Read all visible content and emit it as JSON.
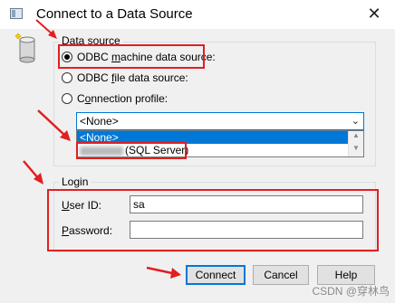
{
  "window": {
    "title": "Connect to a Data Source",
    "close_glyph": "✕"
  },
  "data_source": {
    "legend": "Data source",
    "options": [
      {
        "pre": "ODBC ",
        "accel": "m",
        "post": "achine data source:",
        "checked": true
      },
      {
        "pre": "ODBC ",
        "accel": "f",
        "post": "ile data source:",
        "checked": false
      },
      {
        "pre": "C",
        "accel": "o",
        "post": "nnection profile:",
        "checked": false
      }
    ],
    "select_value": "<None>",
    "dropdown_items": [
      "<None>",
      "(SQL Server)"
    ]
  },
  "login": {
    "legend": "Login",
    "userid_accel": "U",
    "userid_rest": "ser ID:",
    "userid_value": "sa",
    "password_accel": "P",
    "password_rest": "assword:",
    "password_value": ""
  },
  "buttons": {
    "connect": "Connect",
    "cancel": "Cancel",
    "help": "Help"
  },
  "watermark": "CSDN @穿林鸟",
  "colors": {
    "annotation_red": "#e02020",
    "selection_blue": "#0078d7"
  }
}
